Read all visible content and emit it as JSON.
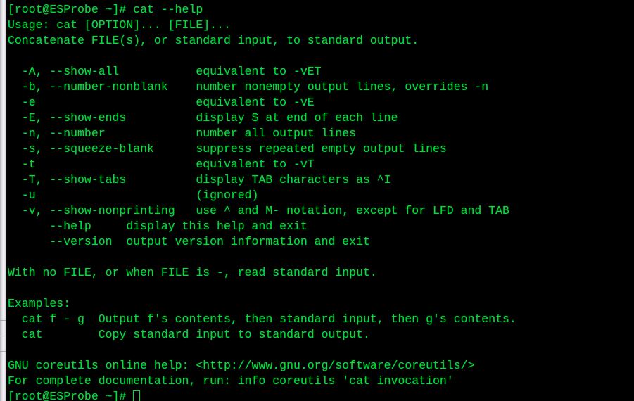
{
  "terminal": {
    "hostname": "ESProbe",
    "user": "root",
    "prompt": "[root@ESProbe ~]# ",
    "command": "cat --help",
    "colors": {
      "foreground": "#00e03c",
      "background": "#000000",
      "gutter": "#efeef2"
    },
    "lines": [
      "[root@ESProbe ~]# cat --help",
      "Usage: cat [OPTION]... [FILE]...",
      "Concatenate FILE(s), or standard input, to standard output.",
      "",
      "  -A, --show-all           equivalent to -vET",
      "  -b, --number-nonblank    number nonempty output lines, overrides -n",
      "  -e                       equivalent to -vE",
      "  -E, --show-ends          display $ at end of each line",
      "  -n, --number             number all output lines",
      "  -s, --squeeze-blank      suppress repeated empty output lines",
      "  -t                       equivalent to -vT",
      "  -T, --show-tabs          display TAB characters as ^I",
      "  -u                       (ignored)",
      "  -v, --show-nonprinting   use ^ and M- notation, except for LFD and TAB",
      "      --help     display this help and exit",
      "      --version  output version information and exit",
      "",
      "With no FILE, or when FILE is -, read standard input.",
      "",
      "Examples:",
      "  cat f - g  Output f's contents, then standard input, then g's contents.",
      "  cat        Copy standard input to standard output.",
      "",
      "GNU coreutils online help: <http://www.gnu.org/software/coreutils/>",
      "For complete documentation, run: info coreutils 'cat invocation'"
    ],
    "final_prompt": "[root@ESProbe ~]# "
  }
}
